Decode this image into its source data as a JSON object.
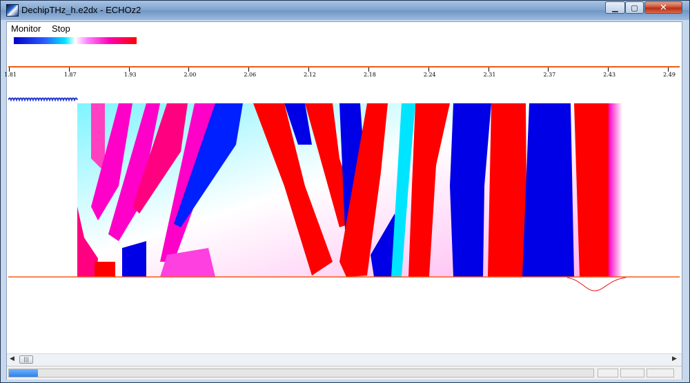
{
  "window": {
    "title": "DechipTHz_h.e2dx - ECHOz2",
    "close_glyph": "✕",
    "min_glyph": "▁",
    "max_glyph": "▢"
  },
  "menu": {
    "items": [
      {
        "label": "Monitor"
      },
      {
        "label": "Stop"
      }
    ]
  },
  "palette": {
    "colors": [
      "#0000c8",
      "#00e8ff",
      "#ffffff",
      "#ff00b4",
      "#ff0000"
    ]
  },
  "ruler": {
    "labels": [
      "1.81",
      "1.87",
      "1.93",
      "2.00",
      "2.06",
      "2.12",
      "2.18",
      "2.24",
      "2.31",
      "2.37",
      "2.43",
      "2.49"
    ]
  },
  "scrollbar": {
    "left_arrow": "◀",
    "right_arrow": "▶",
    "thumb_glyph": "|||"
  },
  "status": {
    "progress": 0.05
  },
  "colors": {
    "accent": "#f05a14",
    "field_red": "#ff0000",
    "field_blue": "#0000e6",
    "field_cyan": "#00e5ff",
    "field_magenta": "#ff00c8"
  }
}
